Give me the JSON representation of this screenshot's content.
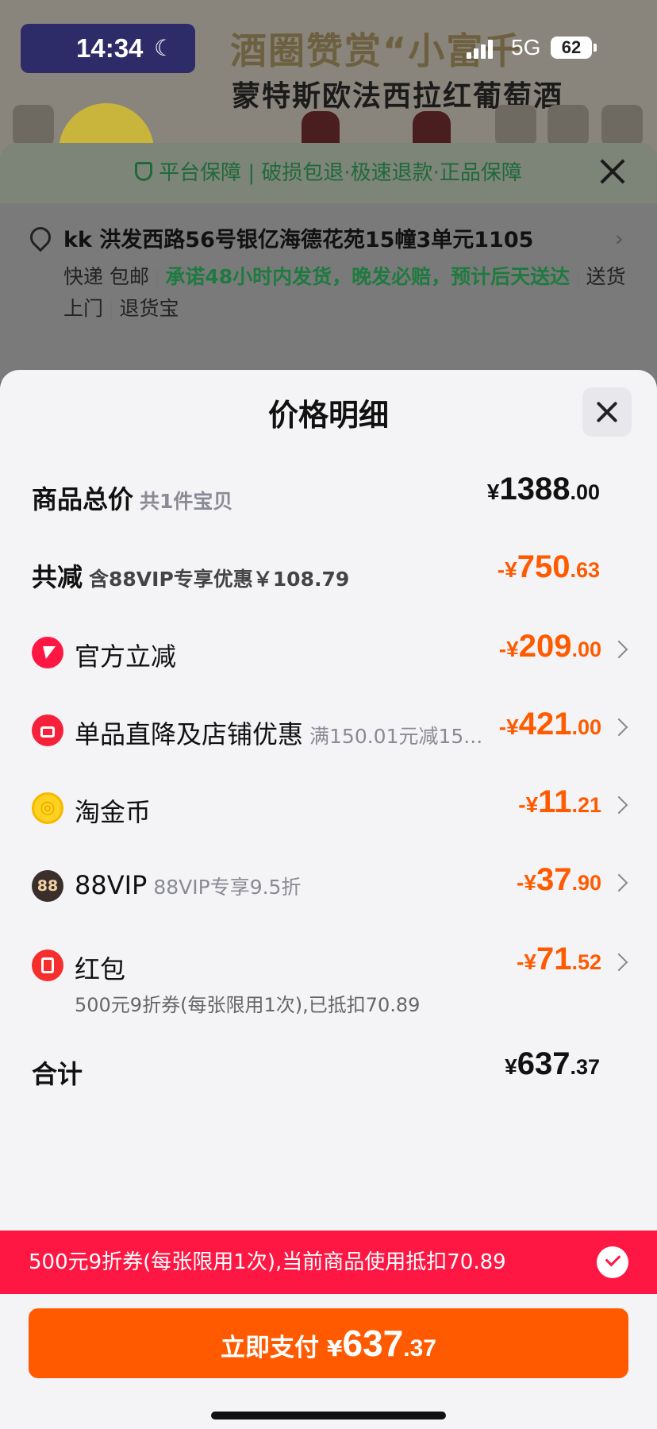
{
  "status_bar": {
    "time": "14:34",
    "network": "5G",
    "battery": "62"
  },
  "background": {
    "shop_banner_line1": "酒圈赞赏“小富千",
    "shop_banner_line2": "蒙特斯欧法西拉红葡萄酒",
    "guarantee_text": "平台保障 | 破损包退·极速退款·正品保障",
    "address": "kk 洪发西路56号银亿海德花苑15幢3单元1105",
    "shipping_method": "快递 包邮",
    "shipping_promise": "承诺48小时内发货，晚发必赔，预计后天送达",
    "delivery_tag": "送货上门",
    "return_tag": "退货宝"
  },
  "sheet": {
    "title": "价格明细",
    "total": {
      "label": "商品总价",
      "sub": "共1件宝贝",
      "prefix": "¥",
      "int": "1388",
      "dec": ".00"
    },
    "reduce": {
      "label": "共减",
      "sub": "含88VIP专享优惠￥108.79",
      "prefix": "-¥",
      "int": "750",
      "dec": ".63"
    },
    "items": [
      {
        "label": "官方立减",
        "sub": "",
        "prefix": "-¥",
        "int": "209",
        "dec": ".00",
        "icon": "lightning-icon"
      },
      {
        "label": "单品直降及店铺优惠",
        "sub": "满150.01元减15...",
        "prefix": "-¥",
        "int": "421",
        "dec": ".00",
        "icon": "shop-icon"
      },
      {
        "label": "淘金币",
        "sub": "",
        "prefix": "-¥",
        "int": "11",
        "dec": ".21",
        "icon": "coin-icon"
      },
      {
        "label": "88VIP",
        "sub": "88VIP专享9.5折",
        "prefix": "-¥",
        "int": "37",
        "dec": ".90",
        "icon": "vip-icon",
        "icon_text": "88"
      },
      {
        "label": "红包",
        "sub": "",
        "prefix": "-¥",
        "int": "71",
        "dec": ".52",
        "icon": "red-envelope-icon"
      }
    ],
    "red_packet_note": "500元9折券(每张限用1次),已抵扣70.89",
    "sum": {
      "label": "合计",
      "prefix": "¥",
      "int": "637",
      "dec": ".37"
    }
  },
  "voucher_bar": {
    "text": "500元9折券(每张限用1次),当前商品使用抵扣70.89"
  },
  "pay_button": {
    "label": "立即支付",
    "prefix": "¥",
    "int": "637",
    "dec": ".37"
  },
  "colors": {
    "accent_orange": "#ff5a00",
    "accent_red": "#ff1744"
  }
}
